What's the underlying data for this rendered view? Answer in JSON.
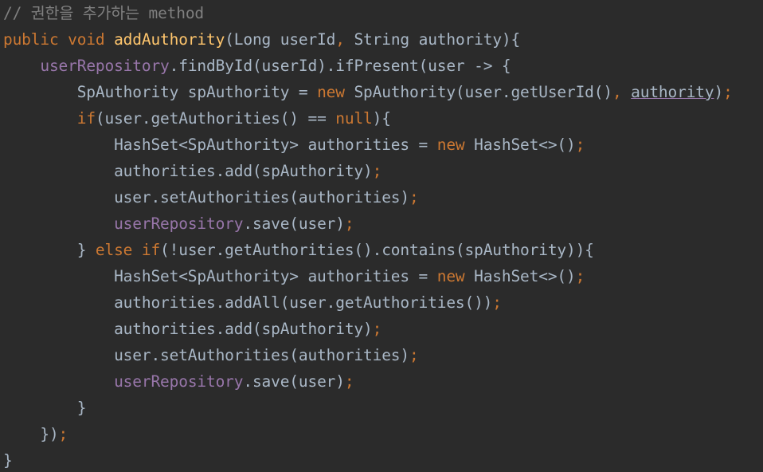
{
  "colors": {
    "background": "#2b2b2b",
    "text": "#a9b7c6",
    "comment": "#808080",
    "keyword": "#cc7832",
    "method_declaration": "#ffc66d",
    "field": "#9876aa"
  },
  "code": {
    "lines": [
      [
        {
          "t": "// 권한을 추가하는 method",
          "k": "comment"
        }
      ],
      [
        {
          "t": "public void ",
          "k": "kw"
        },
        {
          "t": "addAuthority",
          "k": "method"
        },
        {
          "t": "(Long userId",
          "k": "plain"
        },
        {
          "t": ", ",
          "k": "punct"
        },
        {
          "t": "String authority){",
          "k": "plain"
        }
      ],
      [
        {
          "t": "    ",
          "k": "plain"
        },
        {
          "t": "userRepository",
          "k": "field"
        },
        {
          "t": ".findById(userId).ifPresent(user -> {",
          "k": "plain"
        }
      ],
      [
        {
          "t": "        SpAuthority spAuthority = ",
          "k": "plain"
        },
        {
          "t": "new ",
          "k": "kw"
        },
        {
          "t": "SpAuthority(user.getUserId()",
          "k": "plain"
        },
        {
          "t": ", ",
          "k": "punct"
        },
        {
          "t": "authority",
          "k": "underline"
        },
        {
          "t": ")",
          "k": "plain"
        },
        {
          "t": ";",
          "k": "punct"
        }
      ],
      [
        {
          "t": "        ",
          "k": "plain"
        },
        {
          "t": "if",
          "k": "kw"
        },
        {
          "t": "(user.getAuthorities() == ",
          "k": "plain"
        },
        {
          "t": "null",
          "k": "kw"
        },
        {
          "t": "){",
          "k": "plain"
        }
      ],
      [
        {
          "t": "            HashSet<SpAuthority> authorities = ",
          "k": "plain"
        },
        {
          "t": "new ",
          "k": "kw"
        },
        {
          "t": "HashSet<>()",
          "k": "plain"
        },
        {
          "t": ";",
          "k": "punct"
        }
      ],
      [
        {
          "t": "            authorities.add(spAuthority)",
          "k": "plain"
        },
        {
          "t": ";",
          "k": "punct"
        }
      ],
      [
        {
          "t": "            user.setAuthorities(authorities)",
          "k": "plain"
        },
        {
          "t": ";",
          "k": "punct"
        }
      ],
      [
        {
          "t": "            ",
          "k": "plain"
        },
        {
          "t": "userRepository",
          "k": "field"
        },
        {
          "t": ".save(user)",
          "k": "plain"
        },
        {
          "t": ";",
          "k": "punct"
        }
      ],
      [
        {
          "t": "        } ",
          "k": "plain"
        },
        {
          "t": "else if",
          "k": "kw"
        },
        {
          "t": "(!user.getAuthorities().contains(spAuthority)){",
          "k": "plain"
        }
      ],
      [
        {
          "t": "            HashSet<SpAuthority> authorities = ",
          "k": "plain"
        },
        {
          "t": "new ",
          "k": "kw"
        },
        {
          "t": "HashSet<>()",
          "k": "plain"
        },
        {
          "t": ";",
          "k": "punct"
        }
      ],
      [
        {
          "t": "            authorities.addAll(user.getAuthorities())",
          "k": "plain"
        },
        {
          "t": ";",
          "k": "punct"
        }
      ],
      [
        {
          "t": "            authorities.add(spAuthority)",
          "k": "plain"
        },
        {
          "t": ";",
          "k": "punct"
        }
      ],
      [
        {
          "t": "            user.setAuthorities(authorities)",
          "k": "plain"
        },
        {
          "t": ";",
          "k": "punct"
        }
      ],
      [
        {
          "t": "            ",
          "k": "plain"
        },
        {
          "t": "userRepository",
          "k": "field"
        },
        {
          "t": ".save(user)",
          "k": "plain"
        },
        {
          "t": ";",
          "k": "punct"
        }
      ],
      [
        {
          "t": "        }",
          "k": "plain"
        }
      ],
      [
        {
          "t": "    })",
          "k": "plain"
        },
        {
          "t": ";",
          "k": "punct"
        }
      ],
      [
        {
          "t": "}",
          "k": "plain"
        }
      ]
    ]
  }
}
